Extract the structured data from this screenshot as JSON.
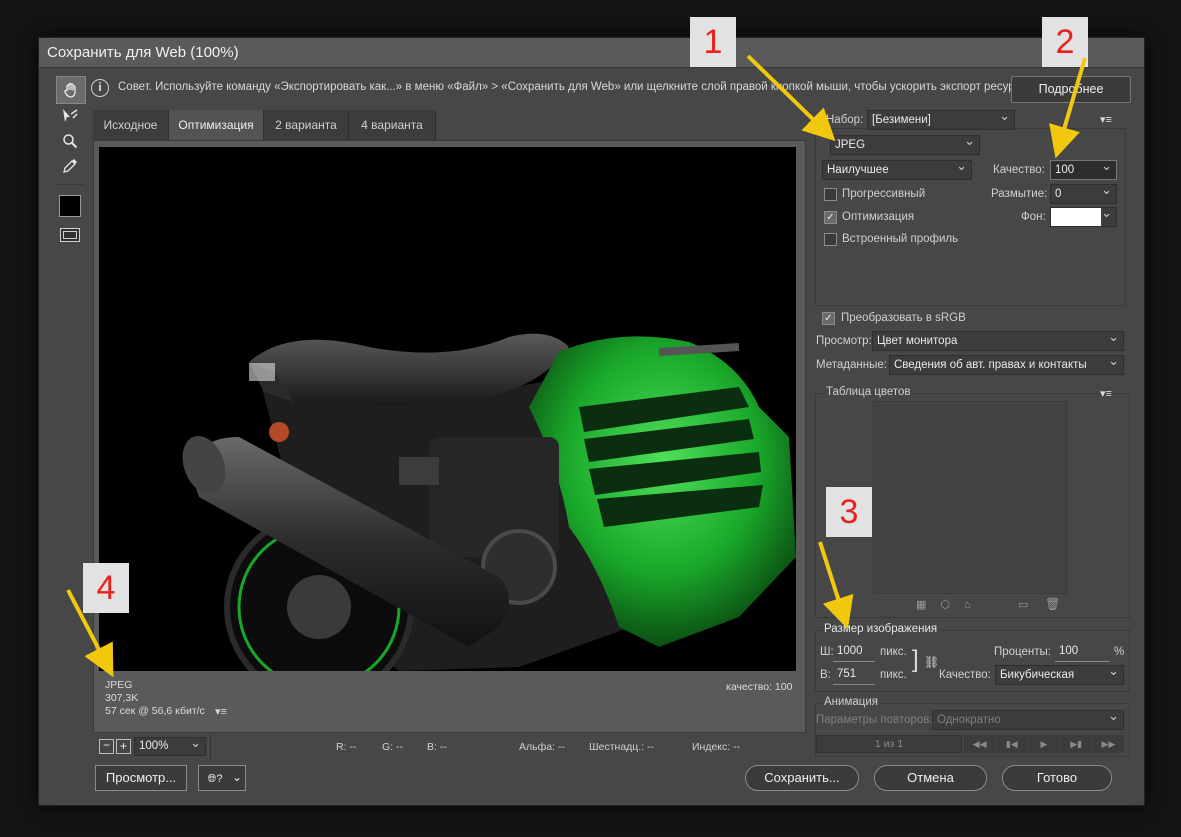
{
  "window": {
    "title": "Сохранить для Web (100%)"
  },
  "hint": {
    "icon": "info-icon",
    "text": "Совет. Используйте команду «Экспортировать как...» в меню «Файл» > «Сохранить для Web» или щелкните слой правой кнопкой мыши, чтобы ускорить экспорт ресурсов",
    "more_label": "Подробнее"
  },
  "tools": [
    "hand-icon",
    "slice-select-icon",
    "zoom-icon",
    "eyedropper-icon",
    "color-swatch",
    "toggle-slices-icon"
  ],
  "tabs": [
    {
      "label": "Исходное",
      "active": false
    },
    {
      "label": "Оптимизация",
      "active": true
    },
    {
      "label": "2 варианта",
      "active": false
    },
    {
      "label": "4 варианта",
      "active": false
    }
  ],
  "preview": {
    "format": "JPEG",
    "size": "307,3K",
    "time": "57 сек @ 56,6 кбит/с",
    "quality_label": "качество: 100"
  },
  "statusbar": {
    "zoom": "100%",
    "r": "R: --",
    "g": "G: --",
    "b": "B: --",
    "alpha": "Альфа: --",
    "hex": "Шестнадц.: --",
    "index": "Индекс: --"
  },
  "buttons": {
    "preview": "Просмотр...",
    "save": "Сохранить...",
    "cancel": "Отмена",
    "done": "Готово"
  },
  "settings": {
    "preset_label": "Набор:",
    "preset_value": "[Безимени]",
    "format": "JPEG",
    "quality_preset": "Наилучшее",
    "quality_label": "Качество:",
    "quality_value": "100",
    "blur_label": "Размытие:",
    "blur_value": "0",
    "matte_label": "Фон:",
    "progressive_label": "Прогрессивный",
    "progressive_checked": false,
    "optimized_label": "Оптимизация",
    "optimized_checked": true,
    "embed_profile_label": "Встроенный профиль",
    "embed_profile_checked": false,
    "convert_srgb_label": "Преобразовать в sRGB",
    "convert_srgb_checked": true,
    "view_label": "Просмотр:",
    "view_value": "Цвет монитора",
    "metadata_label": "Метаданные:",
    "metadata_value": "Сведения об авт. правах и контакты"
  },
  "color_table": {
    "title": "Таблица цветов"
  },
  "image_size": {
    "title": "Размер изображения",
    "w_label": "Ш:",
    "w_value": "1000",
    "h_label": "В:",
    "h_value": "751",
    "unit": "пикс.",
    "percent_label": "Проценты:",
    "percent_value": "100",
    "percent_sign": "%",
    "quality_label": "Качество:",
    "quality_value": "Бикубическая"
  },
  "animation": {
    "title": "Анимация",
    "loop_label": "Параметры повторов:",
    "loop_value": "Однократно",
    "frame_counter": "1 из 1"
  },
  "callouts": [
    "1",
    "2",
    "3",
    "4"
  ],
  "colors": {
    "accent_green": "#1fb32e",
    "callout_red": "#e8231f",
    "arrow_yellow": "#f2c80f"
  }
}
